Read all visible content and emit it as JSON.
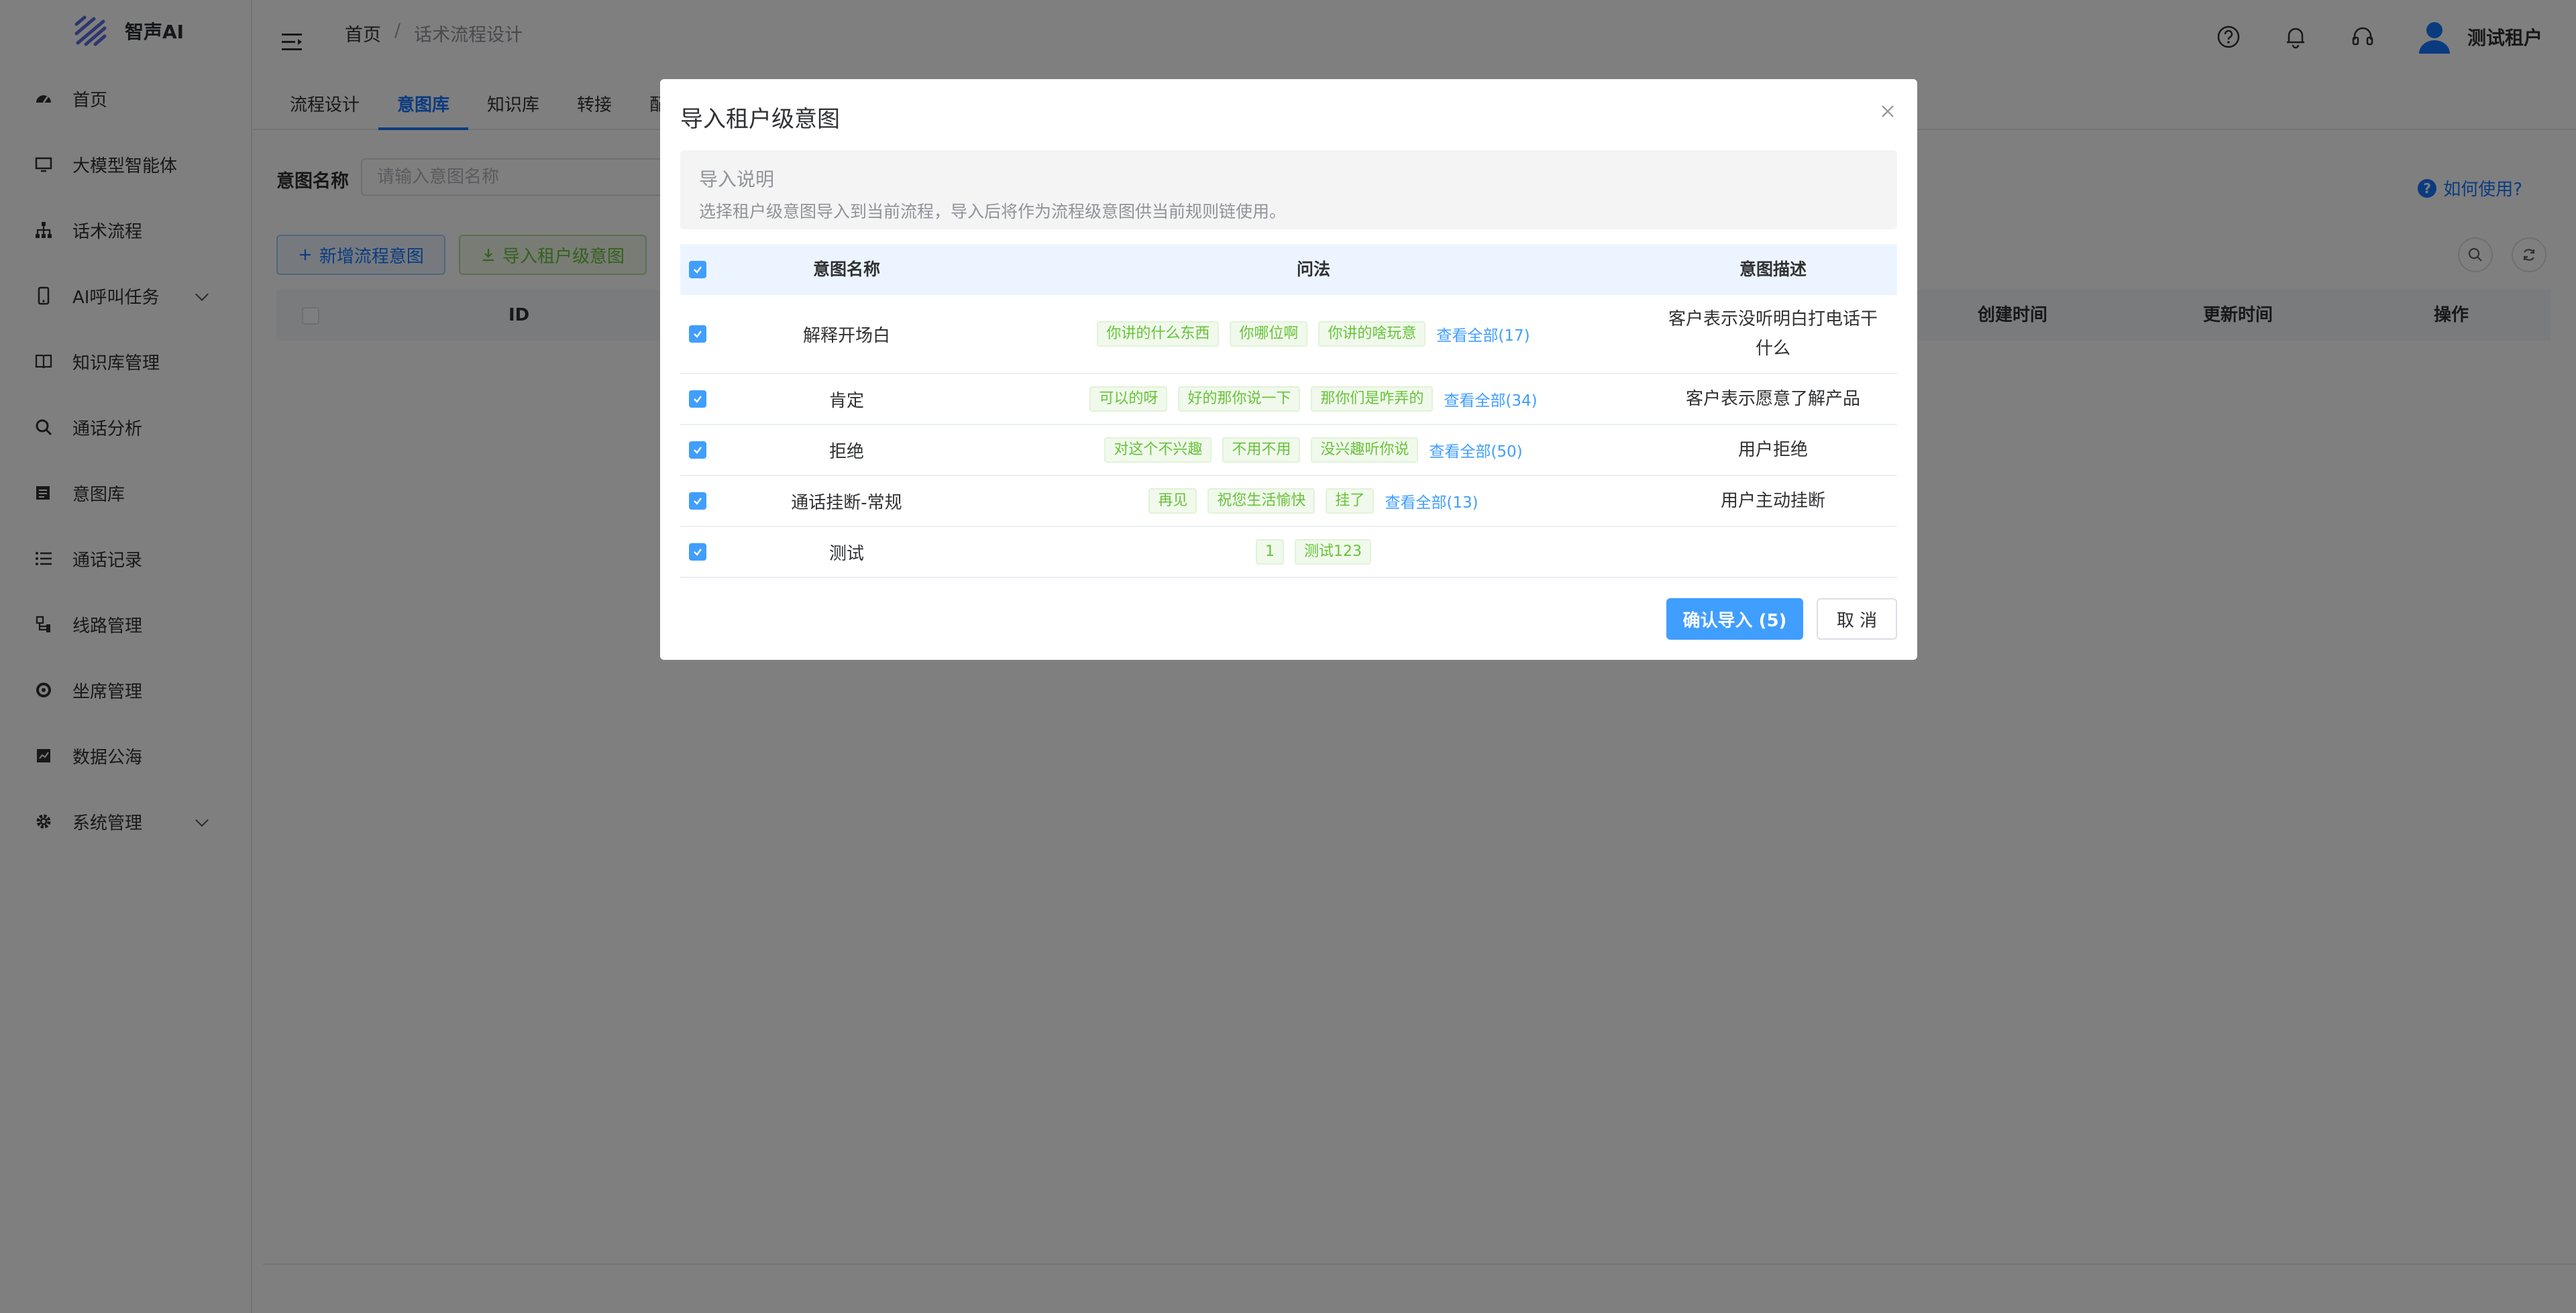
{
  "app": {
    "name": "智声AI"
  },
  "sidebar": {
    "items": [
      {
        "label": "首页",
        "icon": "dashboard-icon"
      },
      {
        "label": "大模型智能体",
        "icon": "monitor-icon"
      },
      {
        "label": "话术流程",
        "icon": "flow-icon"
      },
      {
        "label": "AI呼叫任务",
        "icon": "phone-icon",
        "expandable": true
      },
      {
        "label": "知识库管理",
        "icon": "book-icon"
      },
      {
        "label": "通话分析",
        "icon": "search-icon"
      },
      {
        "label": "意图库",
        "icon": "library-icon"
      },
      {
        "label": "通话记录",
        "icon": "list-icon"
      },
      {
        "label": "线路管理",
        "icon": "route-icon"
      },
      {
        "label": "坐席管理",
        "icon": "seat-icon"
      },
      {
        "label": "数据公海",
        "icon": "data-icon"
      },
      {
        "label": "系统管理",
        "icon": "gear-icon",
        "expandable": true
      }
    ]
  },
  "header": {
    "breadcrumb": {
      "home": "首页",
      "separator": "/",
      "current": "话术流程设计"
    },
    "user_name": "测试租户"
  },
  "tabs": [
    {
      "label": "流程设计",
      "active": false
    },
    {
      "label": "意图库",
      "active": true
    },
    {
      "label": "知识库",
      "active": false
    },
    {
      "label": "转接",
      "active": false
    },
    {
      "label": "配置",
      "active": false
    }
  ],
  "page": {
    "filter_label": "意图名称",
    "filter_placeholder": "请输入意图名称",
    "help_link": "如何使用?",
    "add_button": "新增流程意图",
    "import_button": "导入租户级意图",
    "table_headers": {
      "id": "ID",
      "created": "创建时间",
      "updated": "更新时间",
      "actions": "操作"
    }
  },
  "dialog": {
    "title": "导入租户级意图",
    "notice_title": "导入说明",
    "notice_desc": "选择租户级意图导入到当前流程，导入后将作为流程级意图供当前规则链使用。",
    "headers": {
      "name": "意图名称",
      "phrases": "问法",
      "desc": "意图描述"
    },
    "rows": [
      {
        "checked": true,
        "name": "解释开场白",
        "tags": [
          "你讲的什么东西",
          "你哪位啊",
          "你讲的啥玩意"
        ],
        "view_all": "查看全部(17)",
        "desc": "客户表示没听明白打电话干什么"
      },
      {
        "checked": true,
        "name": "肯定",
        "tags": [
          "可以的呀",
          "好的那你说一下",
          "那你们是咋弄的"
        ],
        "view_all": "查看全部(34)",
        "desc": "客户表示愿意了解产品"
      },
      {
        "checked": true,
        "name": "拒绝",
        "tags": [
          "对这个不兴趣",
          "不用不用",
          "没兴趣听你说"
        ],
        "view_all": "查看全部(50)",
        "desc": "用户拒绝"
      },
      {
        "checked": true,
        "name": "通话挂断-常规",
        "tags": [
          "再见",
          "祝您生活愉快",
          "挂了"
        ],
        "view_all": "查看全部(13)",
        "desc": "用户主动挂断"
      },
      {
        "checked": true,
        "name": "测试",
        "tags": [
          "1",
          "测试123"
        ],
        "view_all": "",
        "desc": ""
      }
    ],
    "confirm_button": "确认导入 (5)",
    "cancel_button": "取 消"
  },
  "colors": {
    "primary": "#409eff",
    "success": "#67c23a",
    "text": "#303133",
    "muted": "#909399"
  }
}
